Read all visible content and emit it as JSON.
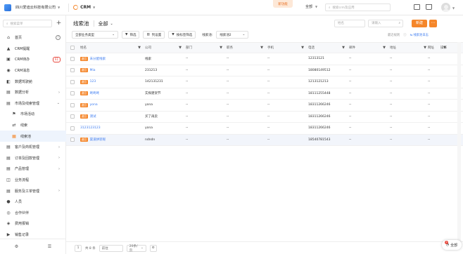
{
  "topbar": {
    "company": "四川爱迪云科技有限公司",
    "app": "CRM",
    "new_feature": "新功能",
    "scope": "全部",
    "search_placeholder": "搜索crm及应用"
  },
  "sidebar": {
    "search_placeholder": "搜索菜单",
    "items": [
      {
        "label": "首页",
        "icon": "home-icon",
        "extra": "help"
      },
      {
        "label": "CRM提醒",
        "icon": "bell-icon"
      },
      {
        "label": "CRM待办",
        "icon": "todo-icon",
        "badge": "61"
      },
      {
        "label": "CRM消息",
        "icon": "message-icon"
      },
      {
        "label": "数据驾驶舱",
        "icon": "dashboard-icon"
      },
      {
        "label": "数据分析",
        "icon": "analytics-icon",
        "arrow": "›"
      },
      {
        "label": "市场及线索管理",
        "icon": "market-icon",
        "arrow": "⌄"
      },
      {
        "label": "市场活动",
        "icon": "flag-icon",
        "sub": true
      },
      {
        "label": "线索",
        "icon": "lead-icon",
        "sub": true
      },
      {
        "label": "线索池",
        "icon": "leadpool-icon",
        "sub": true,
        "active": true
      },
      {
        "label": "客户及商机管理",
        "icon": "customer-icon",
        "arrow": "›"
      },
      {
        "label": "订单及回款管理",
        "icon": "order-icon",
        "arrow": "›"
      },
      {
        "label": "产品管理",
        "icon": "product-icon",
        "arrow": "›"
      },
      {
        "label": "业务流程",
        "icon": "flow-icon"
      },
      {
        "label": "服务及工单管理",
        "icon": "service-icon",
        "arrow": "›"
      },
      {
        "label": "人员",
        "icon": "person-icon"
      },
      {
        "label": "合作伙伴",
        "icon": "partner-icon"
      },
      {
        "label": "费用报销",
        "icon": "expense-icon"
      },
      {
        "label": "销售记录",
        "icon": "record-icon"
      }
    ]
  },
  "main": {
    "title": "线索池",
    "view": "全部",
    "name_placeholder": "姓名",
    "search_placeholder": "请输入",
    "new_button": "新建",
    "biz_type": "全部业务类型",
    "filter": "筛选",
    "column_settings": "列设置",
    "tag_filter": "按标签筛选",
    "pool_label": "线索池:",
    "pool_value": "线索池2",
    "recent": "最近规则",
    "log": "线索池日志"
  },
  "table": {
    "headers": [
      "姓名",
      "公司",
      "部门",
      "职务",
      "手机",
      "电话",
      "邮件",
      "地址",
      "网址",
      "操作"
    ],
    "rows": [
      {
        "tag": "退回",
        "name": "未分配线索",
        "company": "线索",
        "dept": "--",
        "title": "--",
        "mobile": "--",
        "phone": "12313121",
        "email": "--",
        "addr": "--",
        "web": "--"
      },
      {
        "tag": "退回",
        "name": "Mia",
        "company": "231213",
        "dept": "--",
        "title": "--",
        "mobile": "--",
        "phone": "18080149512",
        "email": "--",
        "addr": "--",
        "web": "--"
      },
      {
        "tag": "退回",
        "name": "123",
        "company": "142131231",
        "dept": "--",
        "title": "--",
        "mobile": "--",
        "phone": "1213121213",
        "email": "--",
        "addr": "--",
        "web": "--"
      },
      {
        "tag": "退回",
        "name": "咚咚咚",
        "company": "实探建架节",
        "dept": "--",
        "title": "--",
        "mobile": "--",
        "phone": "18111255448",
        "email": "--",
        "addr": "--",
        "web": "--"
      },
      {
        "tag": "退回",
        "name": "yona",
        "company": "yona",
        "dept": "--",
        "title": "--",
        "mobile": "--",
        "phone": "18311266246",
        "email": "--",
        "addr": "--",
        "web": "--"
      },
      {
        "tag": "退回",
        "name": "测试",
        "company": "买了再卖",
        "dept": "--",
        "title": "--",
        "mobile": "--",
        "phone": "18311266246",
        "email": "--",
        "addr": "--",
        "web": "--"
      },
      {
        "tag": "",
        "name": "3123123123",
        "company": "yona",
        "dept": "--",
        "title": "--",
        "mobile": "--",
        "phone": "18311266246",
        "email": "--",
        "addr": "--",
        "web": "--"
      },
      {
        "tag": "退回",
        "name": "渠道拼装呢",
        "company": "ndndn",
        "dept": "--",
        "title": "--",
        "mobile": "--",
        "phone": "18540781543",
        "email": "--",
        "addr": "--",
        "web": "--"
      }
    ]
  },
  "pager": {
    "page": "1",
    "total": "共 8 条",
    "jump_placeholder": "前往",
    "page_size": "20条/页"
  },
  "float_button": {
    "label": "全部",
    "count": "2"
  }
}
